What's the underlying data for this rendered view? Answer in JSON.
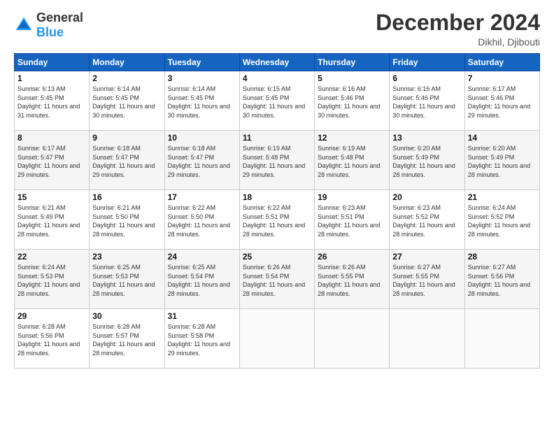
{
  "logo": {
    "general": "General",
    "blue": "Blue"
  },
  "title": "December 2024",
  "subtitle": "Dikhil, Djibouti",
  "days_header": [
    "Sunday",
    "Monday",
    "Tuesday",
    "Wednesday",
    "Thursday",
    "Friday",
    "Saturday"
  ],
  "weeks": [
    [
      {
        "day": "1",
        "sunrise": "6:13 AM",
        "sunset": "5:45 PM",
        "daylight": "11 hours and 31 minutes."
      },
      {
        "day": "2",
        "sunrise": "6:14 AM",
        "sunset": "5:45 PM",
        "daylight": "11 hours and 30 minutes."
      },
      {
        "day": "3",
        "sunrise": "6:14 AM",
        "sunset": "5:45 PM",
        "daylight": "11 hours and 30 minutes."
      },
      {
        "day": "4",
        "sunrise": "6:15 AM",
        "sunset": "5:45 PM",
        "daylight": "11 hours and 30 minutes."
      },
      {
        "day": "5",
        "sunrise": "6:16 AM",
        "sunset": "5:46 PM",
        "daylight": "11 hours and 30 minutes."
      },
      {
        "day": "6",
        "sunrise": "6:16 AM",
        "sunset": "5:46 PM",
        "daylight": "11 hours and 30 minutes."
      },
      {
        "day": "7",
        "sunrise": "6:17 AM",
        "sunset": "5:46 PM",
        "daylight": "11 hours and 29 minutes."
      }
    ],
    [
      {
        "day": "8",
        "sunrise": "6:17 AM",
        "sunset": "5:47 PM",
        "daylight": "11 hours and 29 minutes."
      },
      {
        "day": "9",
        "sunrise": "6:18 AM",
        "sunset": "5:47 PM",
        "daylight": "11 hours and 29 minutes."
      },
      {
        "day": "10",
        "sunrise": "6:18 AM",
        "sunset": "5:47 PM",
        "daylight": "11 hours and 29 minutes."
      },
      {
        "day": "11",
        "sunrise": "6:19 AM",
        "sunset": "5:48 PM",
        "daylight": "11 hours and 29 minutes."
      },
      {
        "day": "12",
        "sunrise": "6:19 AM",
        "sunset": "5:48 PM",
        "daylight": "11 hours and 28 minutes."
      },
      {
        "day": "13",
        "sunrise": "6:20 AM",
        "sunset": "5:49 PM",
        "daylight": "11 hours and 28 minutes."
      },
      {
        "day": "14",
        "sunrise": "6:20 AM",
        "sunset": "5:49 PM",
        "daylight": "11 hours and 28 minutes."
      }
    ],
    [
      {
        "day": "15",
        "sunrise": "6:21 AM",
        "sunset": "5:49 PM",
        "daylight": "11 hours and 28 minutes."
      },
      {
        "day": "16",
        "sunrise": "6:21 AM",
        "sunset": "5:50 PM",
        "daylight": "11 hours and 28 minutes."
      },
      {
        "day": "17",
        "sunrise": "6:22 AM",
        "sunset": "5:50 PM",
        "daylight": "11 hours and 28 minutes."
      },
      {
        "day": "18",
        "sunrise": "6:22 AM",
        "sunset": "5:51 PM",
        "daylight": "11 hours and 28 minutes."
      },
      {
        "day": "19",
        "sunrise": "6:23 AM",
        "sunset": "5:51 PM",
        "daylight": "11 hours and 28 minutes."
      },
      {
        "day": "20",
        "sunrise": "6:23 AM",
        "sunset": "5:52 PM",
        "daylight": "11 hours and 28 minutes."
      },
      {
        "day": "21",
        "sunrise": "6:24 AM",
        "sunset": "5:52 PM",
        "daylight": "11 hours and 28 minutes."
      }
    ],
    [
      {
        "day": "22",
        "sunrise": "6:24 AM",
        "sunset": "5:53 PM",
        "daylight": "11 hours and 28 minutes."
      },
      {
        "day": "23",
        "sunrise": "6:25 AM",
        "sunset": "5:53 PM",
        "daylight": "11 hours and 28 minutes."
      },
      {
        "day": "24",
        "sunrise": "6:25 AM",
        "sunset": "5:54 PM",
        "daylight": "11 hours and 28 minutes."
      },
      {
        "day": "25",
        "sunrise": "6:26 AM",
        "sunset": "5:54 PM",
        "daylight": "11 hours and 28 minutes."
      },
      {
        "day": "26",
        "sunrise": "6:26 AM",
        "sunset": "5:55 PM",
        "daylight": "11 hours and 28 minutes."
      },
      {
        "day": "27",
        "sunrise": "6:27 AM",
        "sunset": "5:55 PM",
        "daylight": "11 hours and 28 minutes."
      },
      {
        "day": "28",
        "sunrise": "6:27 AM",
        "sunset": "5:56 PM",
        "daylight": "11 hours and 28 minutes."
      }
    ],
    [
      {
        "day": "29",
        "sunrise": "6:28 AM",
        "sunset": "5:56 PM",
        "daylight": "11 hours and 28 minutes."
      },
      {
        "day": "30",
        "sunrise": "6:28 AM",
        "sunset": "5:57 PM",
        "daylight": "11 hours and 28 minutes."
      },
      {
        "day": "31",
        "sunrise": "6:28 AM",
        "sunset": "5:58 PM",
        "daylight": "11 hours and 29 minutes."
      },
      null,
      null,
      null,
      null
    ]
  ],
  "sunrise_label": "Sunrise:",
  "sunset_label": "Sunset:",
  "daylight_label": "Daylight:"
}
